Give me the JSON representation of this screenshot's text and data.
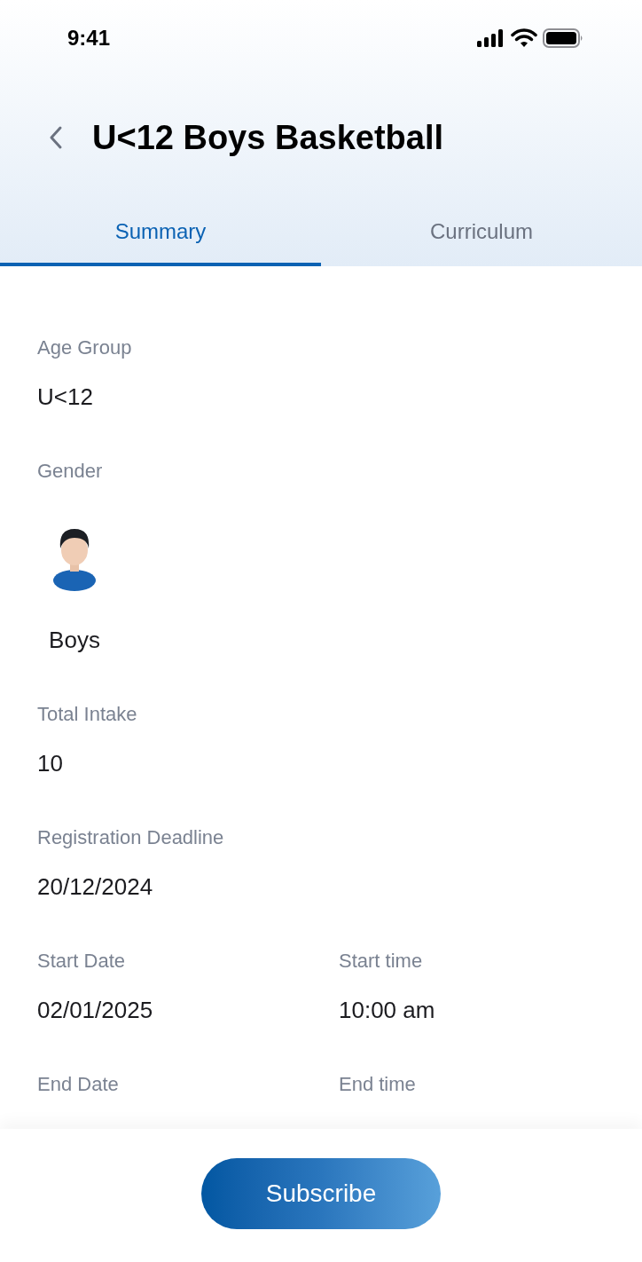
{
  "status_bar": {
    "time": "9:41"
  },
  "header": {
    "title": "U<12 Boys Basketball"
  },
  "tabs": [
    {
      "label": "Summary",
      "selected": true
    },
    {
      "label": "Curriculum",
      "selected": false
    }
  ],
  "rows": [
    {
      "items": [
        {
          "kind": "text",
          "label": "Age Group",
          "value": "U<12"
        }
      ]
    },
    {
      "items": [
        {
          "kind": "gender",
          "label": "Gender",
          "value": "Boys"
        }
      ]
    },
    {
      "items": [
        {
          "kind": "text",
          "label": "Total Intake",
          "value": "10"
        }
      ]
    },
    {
      "items": [
        {
          "kind": "text",
          "label": "Registration Deadline",
          "value": "20/12/2024"
        }
      ]
    },
    {
      "items": [
        {
          "kind": "text",
          "label": "Start Date",
          "value": "02/01/2025"
        },
        {
          "kind": "text",
          "label": "Start time",
          "value": "10:00 am"
        }
      ]
    },
    {
      "items": [
        {
          "kind": "text",
          "label": "End Date"
        },
        {
          "kind": "text",
          "label": "End time"
        }
      ]
    }
  ],
  "footer": {
    "button": "Subscribe"
  }
}
